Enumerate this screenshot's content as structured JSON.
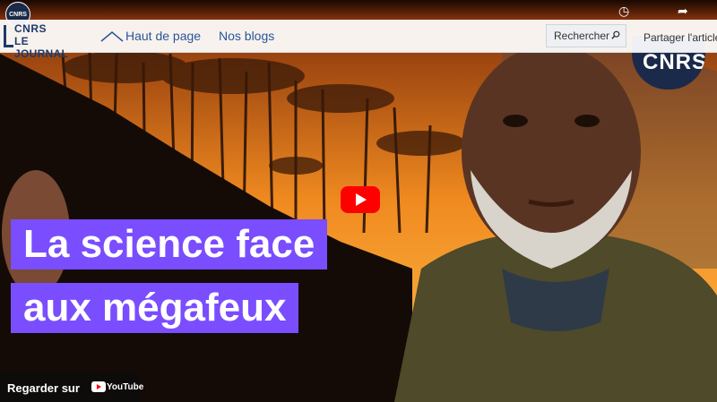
{
  "video": {
    "channel_badge": "CNRS",
    "corner_badge": "CNRS",
    "title_line1": "La science face",
    "title_line2": "aux mégafeux",
    "watch_on_label": "Regarder sur",
    "youtube_label": "YouTube",
    "icons": [
      "clock-icon",
      "share-icon",
      "play-icon"
    ],
    "accent_color": "#7a4dff"
  },
  "header": {
    "logo_line1": "CNRS",
    "logo_line2": "LE JOURNAL",
    "nav": [
      {
        "label": "Haut de page"
      },
      {
        "label": "Nos blogs"
      }
    ],
    "search_placeholder": "Rechercher",
    "share_label": "Partager l'article"
  }
}
